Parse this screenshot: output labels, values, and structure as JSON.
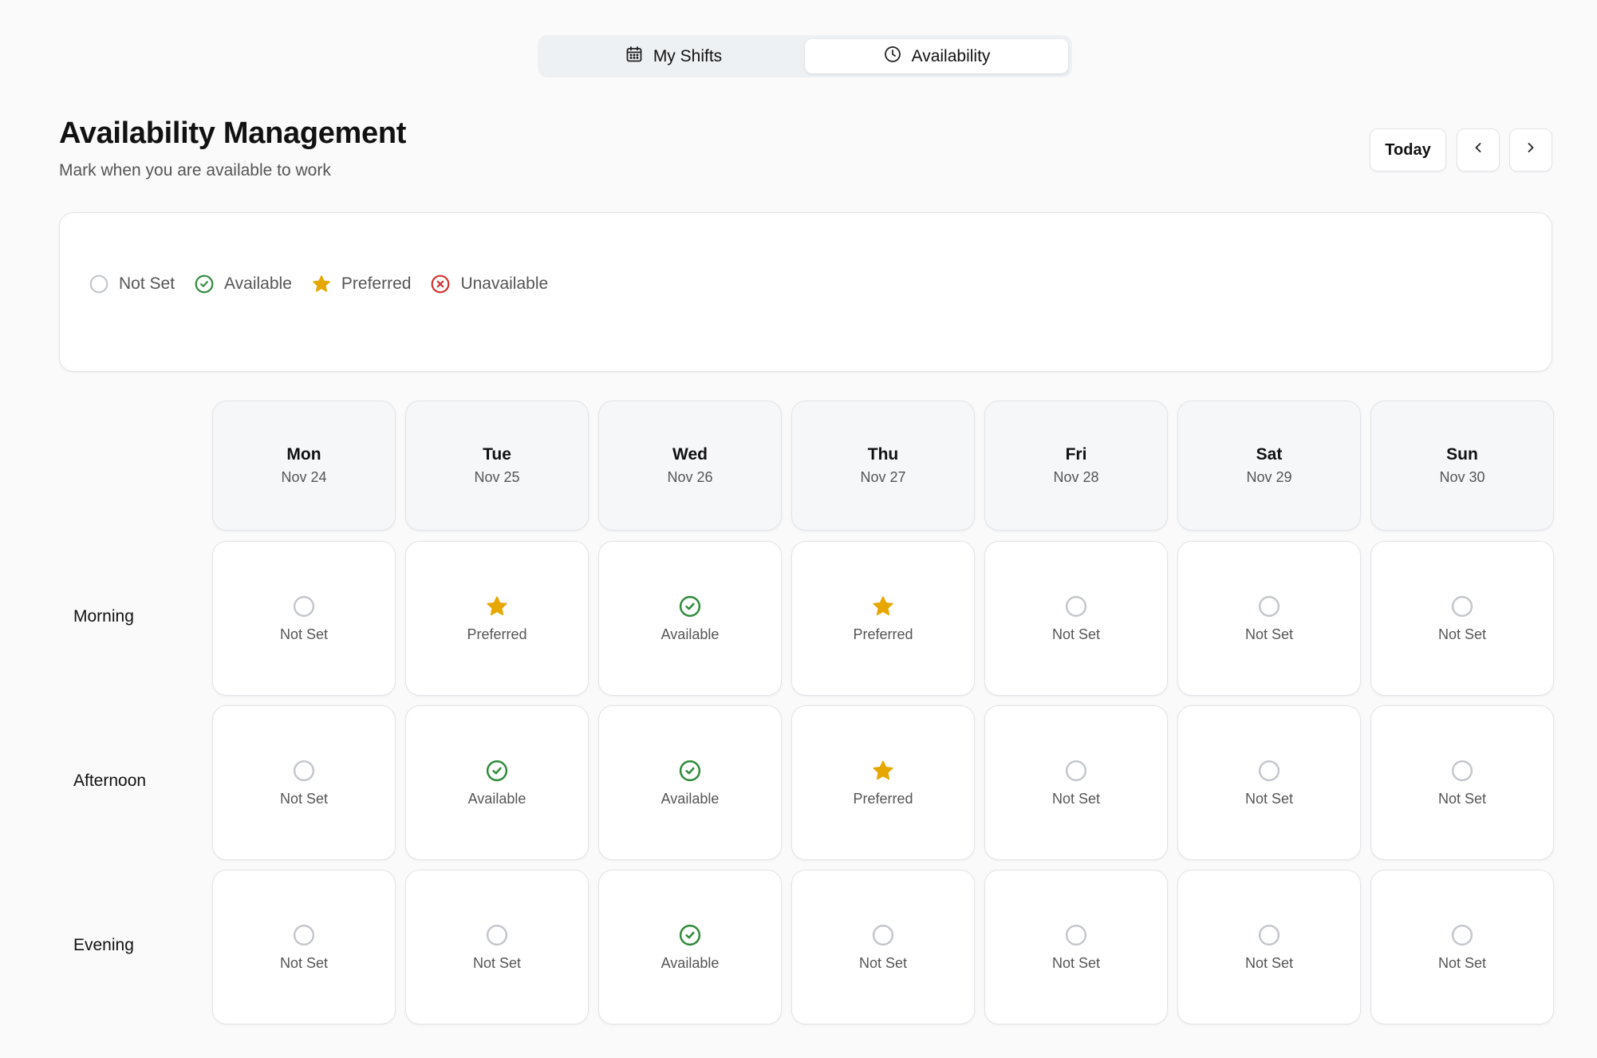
{
  "tabs": [
    {
      "label": "My Shifts",
      "icon": "calendar-icon",
      "active": false
    },
    {
      "label": "Availability",
      "icon": "clock-icon",
      "active": true
    }
  ],
  "header": {
    "title": "Availability Management",
    "subtitle": "Mark when you are available to work",
    "today_label": "Today"
  },
  "legend": [
    {
      "status": "not_set",
      "label": "Not Set"
    },
    {
      "status": "available",
      "label": "Available"
    },
    {
      "status": "preferred",
      "label": "Preferred"
    },
    {
      "status": "unavailable",
      "label": "Unavailable"
    }
  ],
  "colors": {
    "not_set": "#c4c7cc",
    "available": "#2e8b3a",
    "preferred": "#e6a800",
    "unavailable": "#d32f2f"
  },
  "days": [
    {
      "name": "Mon",
      "date": "Nov 24"
    },
    {
      "name": "Tue",
      "date": "Nov 25"
    },
    {
      "name": "Wed",
      "date": "Nov 26"
    },
    {
      "name": "Thu",
      "date": "Nov 27"
    },
    {
      "name": "Fri",
      "date": "Nov 28"
    },
    {
      "name": "Sat",
      "date": "Nov 29"
    },
    {
      "name": "Sun",
      "date": "Nov 30"
    }
  ],
  "slots": [
    {
      "label": "Morning",
      "cells": [
        {
          "status": "not_set",
          "label": "Not Set"
        },
        {
          "status": "preferred",
          "label": "Preferred"
        },
        {
          "status": "available",
          "label": "Available"
        },
        {
          "status": "preferred",
          "label": "Preferred"
        },
        {
          "status": "not_set",
          "label": "Not Set"
        },
        {
          "status": "not_set",
          "label": "Not Set"
        },
        {
          "status": "not_set",
          "label": "Not Set"
        }
      ]
    },
    {
      "label": "Afternoon",
      "cells": [
        {
          "status": "not_set",
          "label": "Not Set"
        },
        {
          "status": "available",
          "label": "Available"
        },
        {
          "status": "available",
          "label": "Available"
        },
        {
          "status": "preferred",
          "label": "Preferred"
        },
        {
          "status": "not_set",
          "label": "Not Set"
        },
        {
          "status": "not_set",
          "label": "Not Set"
        },
        {
          "status": "not_set",
          "label": "Not Set"
        }
      ]
    },
    {
      "label": "Evening",
      "cells": [
        {
          "status": "not_set",
          "label": "Not Set"
        },
        {
          "status": "not_set",
          "label": "Not Set"
        },
        {
          "status": "available",
          "label": "Available"
        },
        {
          "status": "not_set",
          "label": "Not Set"
        },
        {
          "status": "not_set",
          "label": "Not Set"
        },
        {
          "status": "not_set",
          "label": "Not Set"
        },
        {
          "status": "not_set",
          "label": "Not Set"
        }
      ]
    }
  ]
}
